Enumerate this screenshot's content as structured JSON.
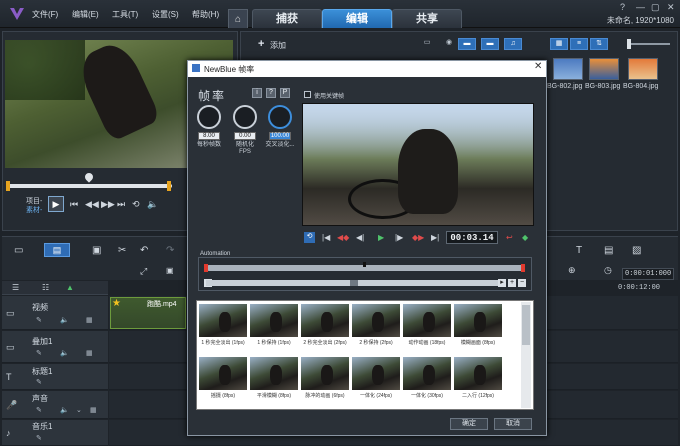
{
  "app": {
    "menu": [
      "文件(F)",
      "编辑(E)",
      "工具(T)",
      "设置(S)",
      "帮助(H)"
    ],
    "tabs": [
      "捕获",
      "编辑",
      "共享"
    ],
    "active_tab": "编辑",
    "project_info": "未命名, 1920*1080"
  },
  "preview": {
    "mode_project": "项目-",
    "mode_clip": "素材-"
  },
  "library": {
    "add_label": "添加",
    "thumbnails": [
      "BG-802.jpg",
      "BG-803.jpg",
      "BG-804.jpg"
    ]
  },
  "timeline": {
    "timecode": "0:00:01:000",
    "ruler_time": "0:00:12:00",
    "clip_name": "跑酷.mp4",
    "tracks": [
      {
        "name": "视频"
      },
      {
        "name": "叠加1"
      },
      {
        "name": "标题1"
      },
      {
        "name": "声音"
      },
      {
        "name": "音乐1"
      }
    ]
  },
  "dialog": {
    "title": "NewBlue 帧率",
    "effect_name": "帧率",
    "header_buttons": [
      "i",
      "?",
      "P"
    ],
    "knobs": [
      {
        "label": "每秒帧数",
        "value": "8.00",
        "level": 0.08
      },
      {
        "label": "随机化 FPS",
        "value": "0.00",
        "level": 0.0
      },
      {
        "label": "交叉淡化...",
        "value": "100.00",
        "level": 1.0
      }
    ],
    "keyframe_label": "使用关键帧",
    "timecode": "00:03.14",
    "automation_label": "Automation",
    "presets": [
      "1 秒完全淡出 (1fps)",
      "1 秒保持 (1fps)",
      "2 秒完全淡出 (2fps)",
      "2 秒保持 (2fps)",
      "动作动画 (18fps)",
      "模糊画面 (8fps)",
      "摇摄 (8fps)",
      "平滑模糊 (8fps)",
      "脉冲的动画 (6fps)",
      "一体化 (24fps)",
      "一体化 (30fps)",
      "二入行 (12fps)"
    ],
    "ok_label": "确定",
    "cancel_label": "取消"
  },
  "colors": {
    "accent": "#2f7fd0",
    "keyframe": "#e23a2e",
    "clip_border": "#6d9a3c"
  }
}
